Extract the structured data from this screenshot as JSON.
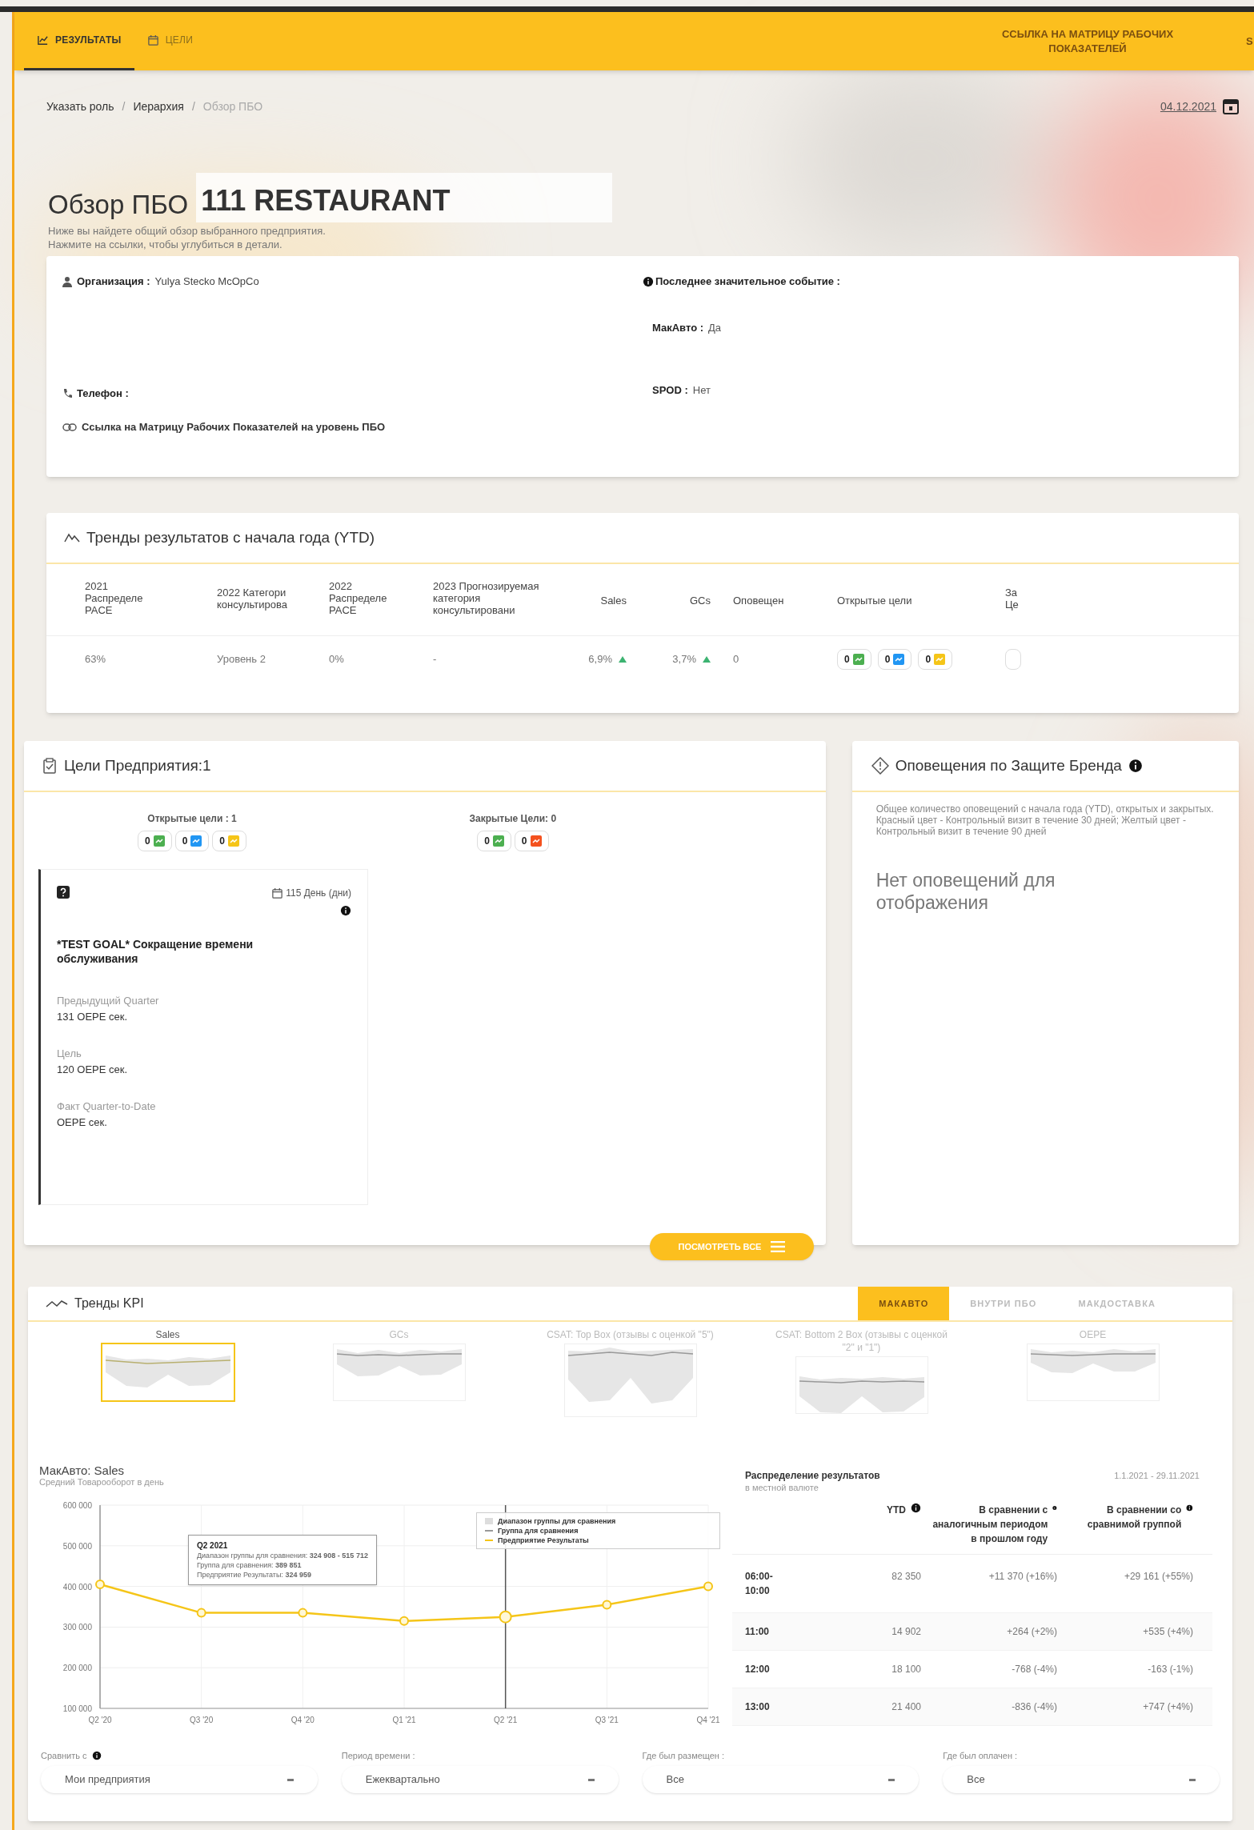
{
  "top_nav": {
    "tabs": [
      {
        "label": "РЕЗУЛЬТАТЫ",
        "selected": true
      },
      {
        "label": "ЦЕЛИ",
        "selected": false
      }
    ],
    "link": "ССЫЛКА НА МАТРИЦУ РАБОЧИХ ПОКАЗАТЕЛЕЙ",
    "cut_item": "S"
  },
  "breadcrumb": [
    {
      "kind": "link",
      "label": "Указать роль"
    },
    {
      "kind": "separator",
      "label": "/"
    },
    {
      "kind": "link",
      "label": "Иерархия"
    },
    {
      "kind": "separator",
      "label": "/"
    },
    {
      "kind": "current",
      "label": "Обзор ПБО"
    }
  ],
  "date": "04.12.2021",
  "title": "Обзор ПБО",
  "restaurant": "111 RESTAURANT",
  "subtitle": [
    "Ниже вы найдете общий обзор выбранного предприятия.",
    "Нажмите на ссылки, чтобы углубиться в детали."
  ],
  "info": {
    "organization": {
      "label": "Организация :",
      "value": "Yulya Stecko McOpCo"
    },
    "phone": {
      "label": "Телефон :"
    },
    "matrix_link": "Ссылка на Матрицу Рабочих Показателей на уровень ПБО",
    "last_event": {
      "label": "Последнее значительное событие :"
    },
    "fields": [
      {
        "label": "МакАвто :",
        "value": "Да"
      },
      {
        "label": "SPOD :",
        "value": "Нет"
      }
    ]
  },
  "ytd": {
    "title": "Тренды результатов с начала года (YTD)",
    "columns": [
      "2021 Распределе PACE",
      "2022 Категори консультирова",
      "2022 Распределе PACE",
      "2023 Прогнозируемая категория консультировани",
      "Sales",
      "GCs",
      "Оповещен",
      "Открытые цели",
      "За Це"
    ],
    "row": [
      {
        "kind": "text",
        "text": "63%"
      },
      {
        "kind": "text",
        "text": "Уровень 2"
      },
      {
        "kind": "text",
        "text": "0%"
      },
      {
        "kind": "text",
        "text": "-"
      },
      {
        "kind": "trend_up",
        "text": "6,9%"
      },
      {
        "kind": "trend_up",
        "text": "3,7%"
      },
      {
        "kind": "text",
        "text": "0"
      },
      {
        "kind": "badges",
        "badges": [
          {
            "count": "0",
            "color": "#4caf50"
          },
          {
            "count": "0",
            "color": "#2196f3"
          },
          {
            "count": "0",
            "color": "#f5c518"
          }
        ]
      },
      {
        "kind": "cut_badge"
      }
    ]
  },
  "goals": {
    "title": "Цели Предприятия:1",
    "groups": [
      {
        "label": "Открытые цели : 1",
        "badges": [
          {
            "count": "0",
            "color": "#4caf50"
          },
          {
            "count": "0",
            "color": "#2196f3"
          },
          {
            "count": "0",
            "color": "#f5c518"
          }
        ]
      },
      {
        "label": "Закрытые Цели: 0",
        "badges": [
          {
            "count": "0",
            "color": "#4caf50"
          },
          {
            "count": "0",
            "color": "#f4511e"
          }
        ]
      }
    ],
    "card": {
      "days": "115 День (дни)",
      "title": "*TEST GOAL* Сокращение времени обслуживания",
      "facts": [
        {
          "label": "Предыдущий Quarter",
          "value": "131 OEPE сек."
        },
        {
          "label": "Цель",
          "value": "120 OEPE сек."
        },
        {
          "label": "Факт Quarter-to-Date",
          "value": "OEPE сек."
        }
      ]
    },
    "view_all": "ПОСМОТРЕТЬ ВСЕ"
  },
  "alerts": {
    "title": "Оповещения по Защите Бренда",
    "description": "Общее количество оповещений с начала года (YTD), открытых и закрытых. Красный цвет - Контрольный визит в течение 30 дней; Желтый цвет - Контрольный визит в течение 90 дней",
    "empty": "Нет оповещений для отображения"
  },
  "kpi": {
    "title": "Тренды KPI",
    "tabs": [
      {
        "label": "МАКАВТО",
        "selected": true
      },
      {
        "label": "ВНУТРИ ПБО",
        "selected": false
      },
      {
        "label": "МАКДОСТАВКА",
        "selected": false
      }
    ],
    "thumbnails": [
      {
        "label": "Sales",
        "selected": true
      },
      {
        "label": "GCs",
        "selected": false
      },
      {
        "label": "CSAT: Top Box (отзывы с оценкой \"5\")",
        "selected": false
      },
      {
        "label": "CSAT: Bottom 2 Box (отзывы с оценкой \"2\" и \"1\")",
        "selected": false
      },
      {
        "label": "OEPE",
        "selected": false
      }
    ],
    "chart_title": "МакАвто: Sales",
    "chart_subtitle": "Средний Товарооборот в день",
    "chart_data": {
      "type": "line",
      "categories": [
        "Q2 '20",
        "Q3 '20",
        "Q4 '20",
        "Q1 '21",
        "Q2 '21",
        "Q3 '21",
        "Q4 '21"
      ],
      "grid": true,
      "ref_lines": [
        {
          "axis": "x",
          "value": "Q2 '21"
        }
      ],
      "series": [
        {
          "name": "Предприятие Результаты",
          "color": "#f5c518",
          "marker": "circle",
          "values": [
            405000,
            335000,
            335000,
            315000,
            325000,
            355000,
            400000
          ]
        }
      ],
      "ylim": [
        100000,
        600000
      ],
      "yticks": [
        {
          "value": 100000,
          "label": "100 000"
        },
        {
          "value": 200000,
          "label": "200 000"
        },
        {
          "value": 300000,
          "label": "300 000"
        },
        {
          "value": 400000,
          "label": "400 000"
        },
        {
          "value": 500000,
          "label": "500 000"
        },
        {
          "value": 600000,
          "label": "600 000"
        }
      ]
    },
    "tooltip": {
      "title": "Q2 2021",
      "lines": [
        "Диапазон группы для сравнения: **324 908 - 515 712**",
        "Группа для сравнения: **389 851**",
        "Предприятие Результаты: **324 959**"
      ]
    },
    "legend": [
      "Диапазон группы для сравнения",
      "Группа для сравнения"
    ],
    "filters": [
      {
        "label": "Сравнить с",
        "info": true,
        "value": "Мои предприятия"
      },
      {
        "label": "Период времени :",
        "info": false,
        "value": "Ежеквартально"
      },
      {
        "label": "Где был размещен :",
        "info": false,
        "value": "Все"
      },
      {
        "label": "Где был оплачен :",
        "info": false,
        "value": "Все"
      }
    ],
    "table": {
      "title": "Распределение результатов",
      "subtitle": "в местной валюте",
      "period": "1.1.2021 - 29.11.2021",
      "columns": [
        {
          "label": "YTD",
          "info": true
        },
        {
          "label": "В сравнении с аналогичным периодом в прошлом году",
          "info": true
        },
        {
          "label": "В сравнении со сравнимой группой",
          "info": true
        }
      ],
      "rows": [
        {
          "label": "06:00-10:00",
          "cells": [
            "82 350",
            "+11 370 (+16%)",
            "+29 161 (+55%)"
          ]
        },
        {
          "label": "11:00",
          "cells": [
            "14 902",
            "+264 (+2%)",
            "+535 (+4%)"
          ]
        },
        {
          "label": "12:00",
          "cells": [
            "18 100",
            "-768 (-4%)",
            "-163 (-1%)"
          ]
        },
        {
          "label": "13:00",
          "cells": [
            "21 400",
            "-836 (-4%)",
            "+747 (+4%)"
          ]
        }
      ]
    }
  }
}
